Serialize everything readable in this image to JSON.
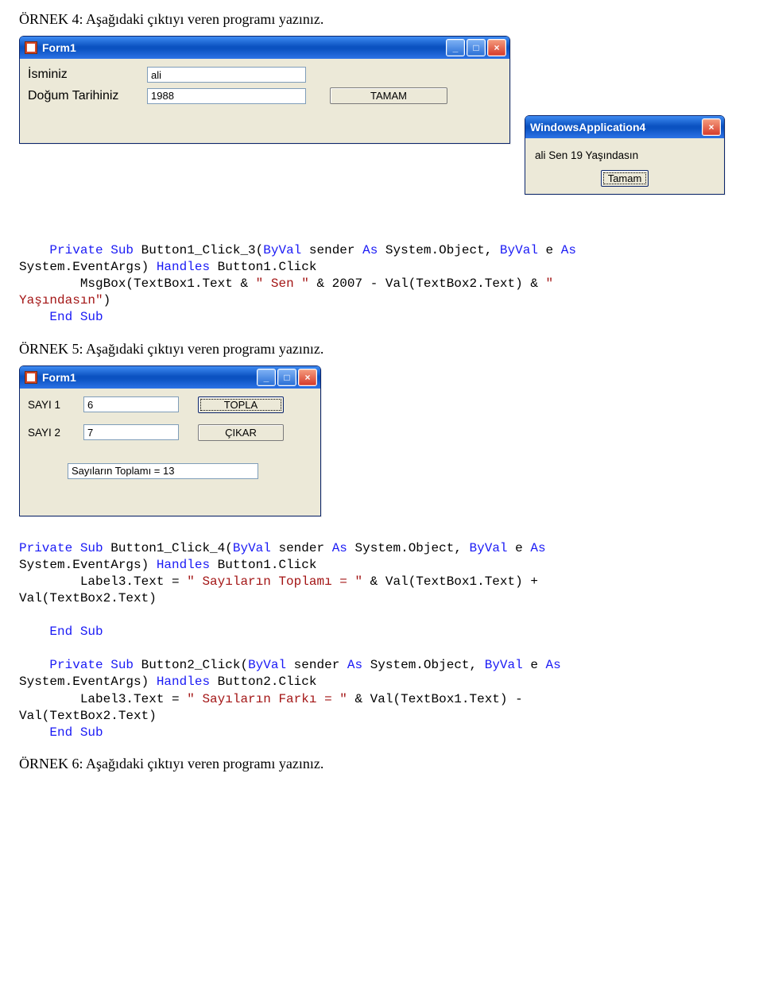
{
  "heading4": "ÖRNEK 4: Aşağıdaki çıktıyı veren programı yazınız.",
  "heading5": "ÖRNEK 5: Aşağıdaki çıktıyı veren programı yazınız.",
  "heading6": "ÖRNEK 6: Aşağıdaki çıktıyı veren programı yazınız.",
  "form1": {
    "title": "Form1",
    "label_name": "İsminiz",
    "label_dob": "Doğum Tarihiniz",
    "textbox1_value": "ali",
    "textbox2_value": "1988",
    "btn_tamam": "TAMAM"
  },
  "msgbox": {
    "title": "WindowsApplication4",
    "text": "ali Sen 19 Yaşındasın",
    "btn_ok": "Tamam"
  },
  "form2": {
    "title": "Form1",
    "label_s1": "SAYI 1",
    "label_s2": "SAYI 2",
    "textbox1_value": "6",
    "textbox2_value": "7",
    "btn_topla": "TOPLA",
    "btn_cikar": "ÇIKAR",
    "label3_value": "Sayıların Toplamı = 13"
  },
  "code1": {
    "l1_a": "    Private",
    "l1_b": " Sub",
    "l1_c": " Button1_Click_3(",
    "l1_d": "ByVal",
    "l1_e": " sender ",
    "l1_f": "As",
    "l1_g": " System.Object, ",
    "l1_h": "ByVal",
    "l1_i": " e ",
    "l1_j": "As",
    "l2_a": "System.EventArgs) ",
    "l2_b": "Handles",
    "l2_c": " Button1.Click",
    "l3_a": "        MsgBox(TextBox1.Text & ",
    "l3_b": "\" Sen \"",
    "l3_c": " & 2007 - Val(TextBox2.Text) & ",
    "l3_d": "\" ",
    "l4_a": "Yaşındasın\"",
    "l4_b": ")",
    "l5_a": "    End",
    "l5_b": " Sub"
  },
  "code2": {
    "l1_a": "Private",
    "l1_b": " Sub",
    "l1_c": " Button1_Click_4(",
    "l1_d": "ByVal",
    "l1_e": " sender ",
    "l1_f": "As",
    "l1_g": " System.Object, ",
    "l1_h": "ByVal",
    "l1_i": " e ",
    "l1_j": "As",
    "l2_a": "System.EventArgs) ",
    "l2_b": "Handles",
    "l2_c": " Button1.Click",
    "l3_a": "        Label3.Text = ",
    "l3_b": "\" Sayıların Toplamı = \"",
    "l3_c": " & Val(TextBox1.Text) + ",
    "l4_a": "Val(TextBox2.Text)",
    "l6_a": "    End",
    "l6_b": " Sub",
    "l8_a": "    Private",
    "l8_b": " Sub",
    "l8_c": " Button2_Click(",
    "l8_d": "ByVal",
    "l8_e": " sender ",
    "l8_f": "As",
    "l8_g": " System.Object, ",
    "l8_h": "ByVal",
    "l8_i": " e ",
    "l8_j": "As",
    "l9_a": "System.EventArgs) ",
    "l9_b": "Handles",
    "l9_c": " Button2.Click",
    "l10_a": "        Label3.Text = ",
    "l10_b": "\" Sayıların Farkı = \"",
    "l10_c": " & Val(TextBox1.Text) - ",
    "l11_a": "Val(TextBox2.Text)",
    "l12_a": "    End",
    "l12_b": " Sub"
  }
}
